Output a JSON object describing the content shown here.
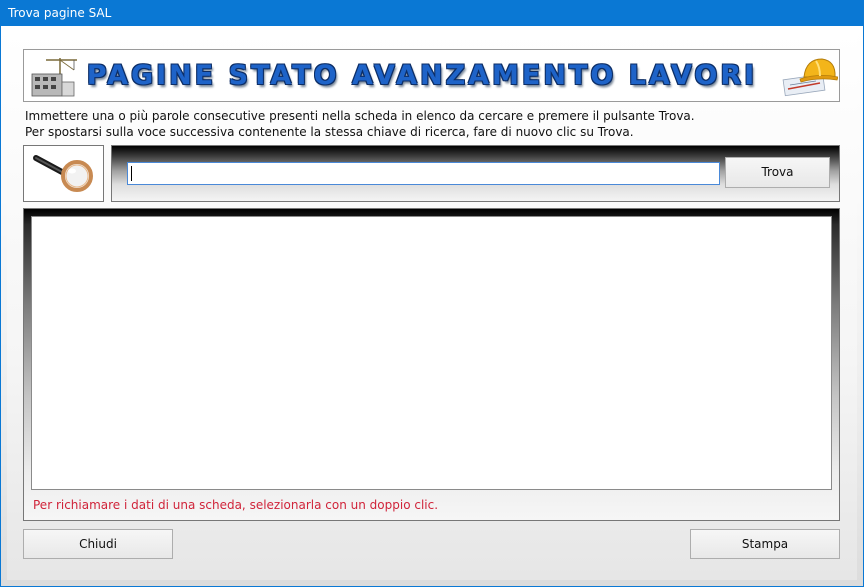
{
  "window": {
    "title": "Trova pagine SAL"
  },
  "banner": {
    "title": "PAGINE STATO AVANZAMENTO LAVORI",
    "left_image_icon": "building-construction-icon",
    "right_image_icon": "hardhat-blueprint-icon"
  },
  "instructions": {
    "line1": "Immettere una o più parole consecutive presenti nella scheda in elenco da cercare e premere il pulsante Trova.",
    "line2": "Per spostarsi sulla voce successiva contenente la stessa chiave di ricerca, fare di nuovo clic su Trova."
  },
  "search": {
    "icon": "magnifier-icon",
    "value": "",
    "placeholder": "",
    "button_label": "Trova"
  },
  "results": {
    "items": [],
    "hint": "Per richiamare i dati di una scheda, selezionarla con un doppio clic."
  },
  "footer": {
    "close_label": "Chiudi",
    "print_label": "Stampa"
  },
  "colors": {
    "titlebar": "#0a78d4",
    "banner_text": "#1e63c8",
    "hint_text": "#d0243a",
    "input_border": "#4a89d8"
  }
}
